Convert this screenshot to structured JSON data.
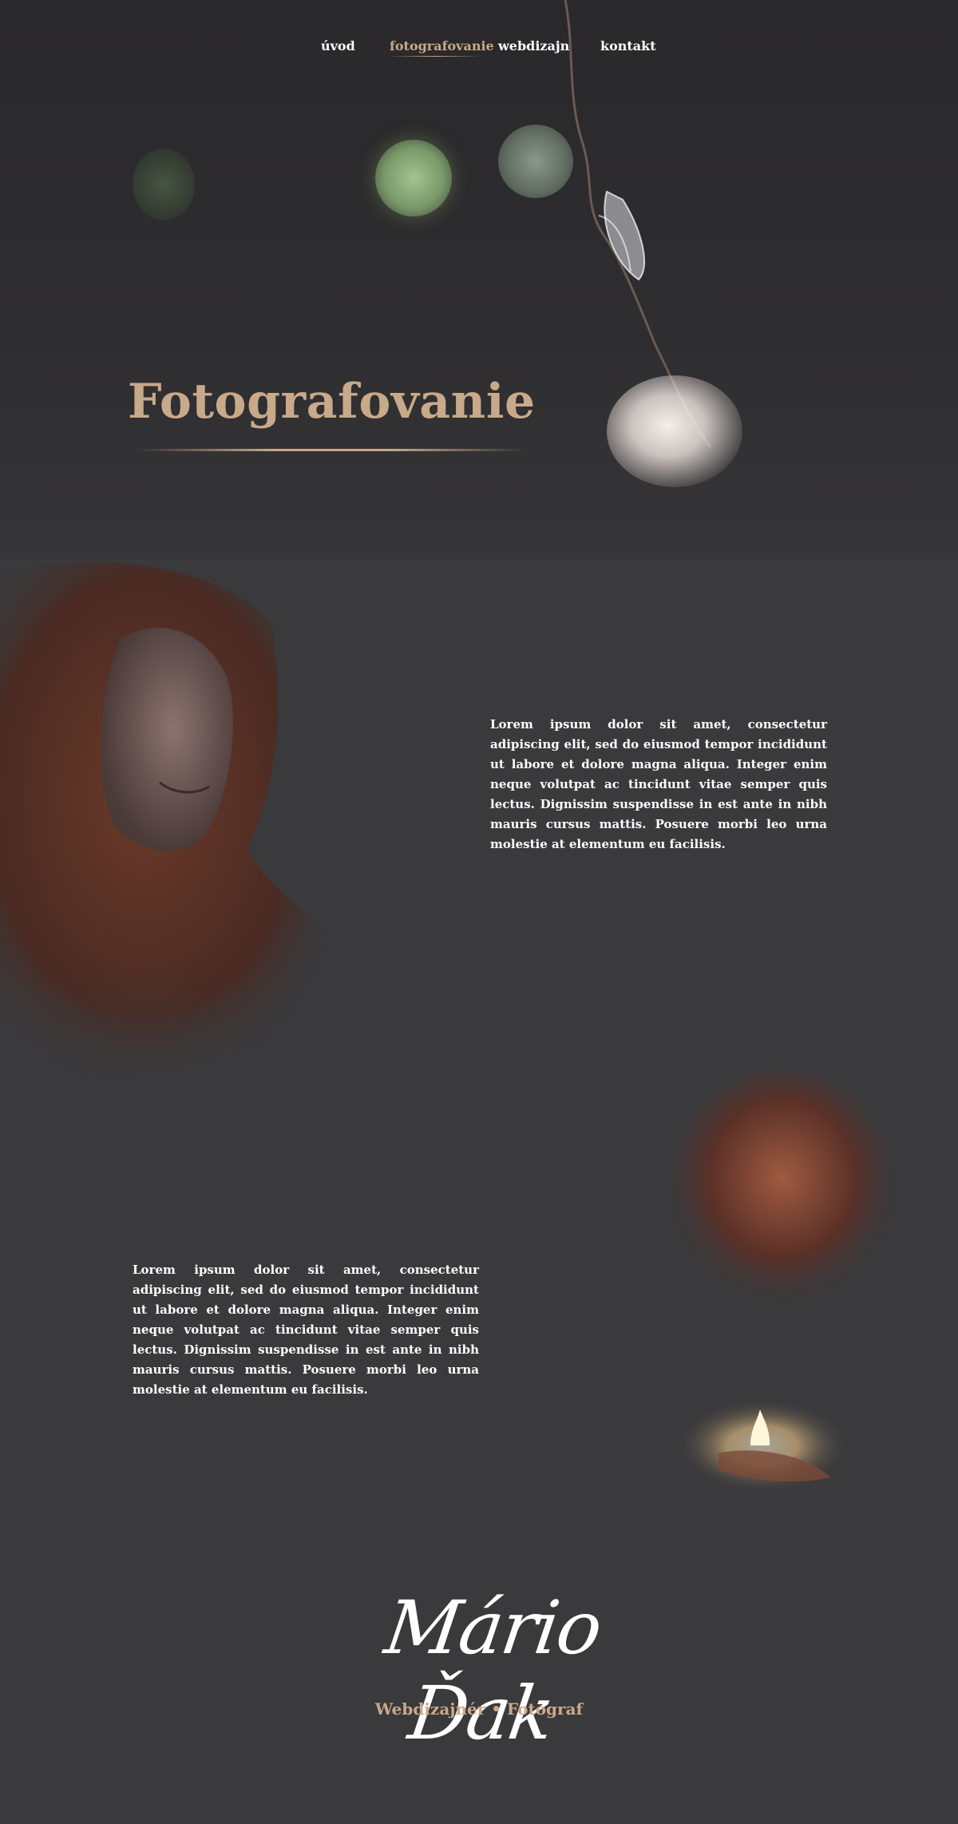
{
  "nav": {
    "items": [
      {
        "label": "úvod",
        "active": false
      },
      {
        "label": "fotografovanie",
        "active": true
      },
      {
        "label": "webdizajn",
        "active": false
      },
      {
        "label": "kontakt",
        "active": false
      }
    ]
  },
  "hero": {
    "title": "Fotografovanie"
  },
  "sections": [
    {
      "text": "Lorem ipsum dolor sit amet, consectetur adipiscing elit, sed do eiusmod tempor incididunt ut labore et dolore magna aliqua. Integer enim neque volutpat ac tincidunt vitae semper quis lectus. Dignissim suspendisse in est ante in nibh mauris cursus mattis. Posuere morbi leo urna molestie at elementum eu facilisis."
    },
    {
      "text": "Lorem ipsum dolor sit amet, consectetur adipiscing elit, sed do eiusmod tempor incididunt ut labore et dolore magna aliqua. Integer enim neque volutpat ac tincidunt vitae semper quis lectus. Dignissim suspendisse in est ante in nibh mauris cursus mattis. Posuere morbi leo urna molestie at elementum eu facilisis."
    }
  ],
  "footer": {
    "signature": "Mário Ďak",
    "tagline": "Webdizajnér • Fotograf"
  },
  "colors": {
    "accent": "#c8a98a",
    "background": "#3a393b",
    "text": "#ffffff"
  }
}
